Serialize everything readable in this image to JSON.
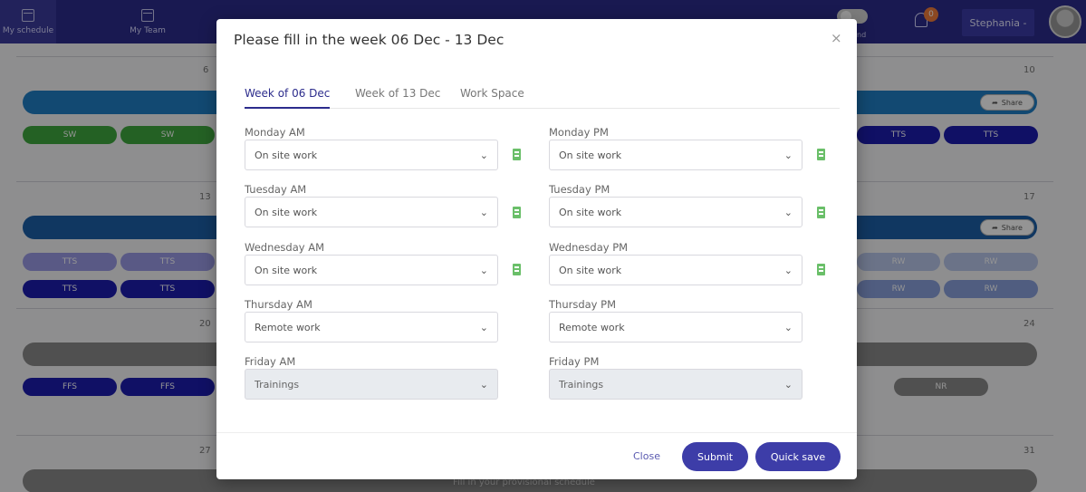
{
  "nav": {
    "items": [
      {
        "label": "My schedule",
        "icon": "calendar-icon"
      },
      {
        "label": "My Team",
        "icon": "team-calendar-icon"
      }
    ],
    "toggle_label": "nd",
    "notifications_count": "0",
    "user_name": "Stephania -"
  },
  "schedule": {
    "day_numbers": [
      "6",
      "10",
      "13",
      "17",
      "20",
      "24",
      "27",
      "31"
    ],
    "share_label": "Share",
    "pills": [
      "SW",
      "SW",
      "TTS",
      "TTS",
      "TTS",
      "TTS",
      "RW",
      "RW",
      "TTS",
      "TTS",
      "RW",
      "RW",
      "FFS",
      "FFS",
      "NR"
    ],
    "bottom_caption": "Fill in your provisional schedule"
  },
  "modal": {
    "title": "Please fill in the week 06 Dec - 13 Dec",
    "close_icon": "×",
    "tabs": [
      "Week of 06 Dec",
      "Week of 13 Dec",
      "Work Space"
    ],
    "fields": [
      {
        "label": "Monday AM",
        "value": "On site work",
        "icon": "building-icon"
      },
      {
        "label": "Monday PM",
        "value": "On site work",
        "icon": "building-icon"
      },
      {
        "label": "Tuesday AM",
        "value": "On site work",
        "icon": "building-icon"
      },
      {
        "label": "Tuesday PM",
        "value": "On site work",
        "icon": "building-icon"
      },
      {
        "label": "Wednesday AM",
        "value": "On site work",
        "icon": "building-icon"
      },
      {
        "label": "Wednesday PM",
        "value": "On site work",
        "icon": "building-icon"
      },
      {
        "label": "Thursday AM",
        "value": "Remote work"
      },
      {
        "label": "Thursday PM",
        "value": "Remote work"
      },
      {
        "label": "Friday AM",
        "value": "Trainings",
        "disabled": true
      },
      {
        "label": "Friday PM",
        "value": "Trainings",
        "disabled": true
      }
    ],
    "close_label": "Close",
    "submit_label": "Submit",
    "quick_save_label": "Quick save"
  },
  "colors": {
    "primary": "#2c2c8c",
    "button": "#3d3da8",
    "green": "#3fa83f",
    "blue": "#1f7ec4",
    "navy": "#1c1cae",
    "building_icon": "#6abf69",
    "badge": "#f07d3c"
  }
}
